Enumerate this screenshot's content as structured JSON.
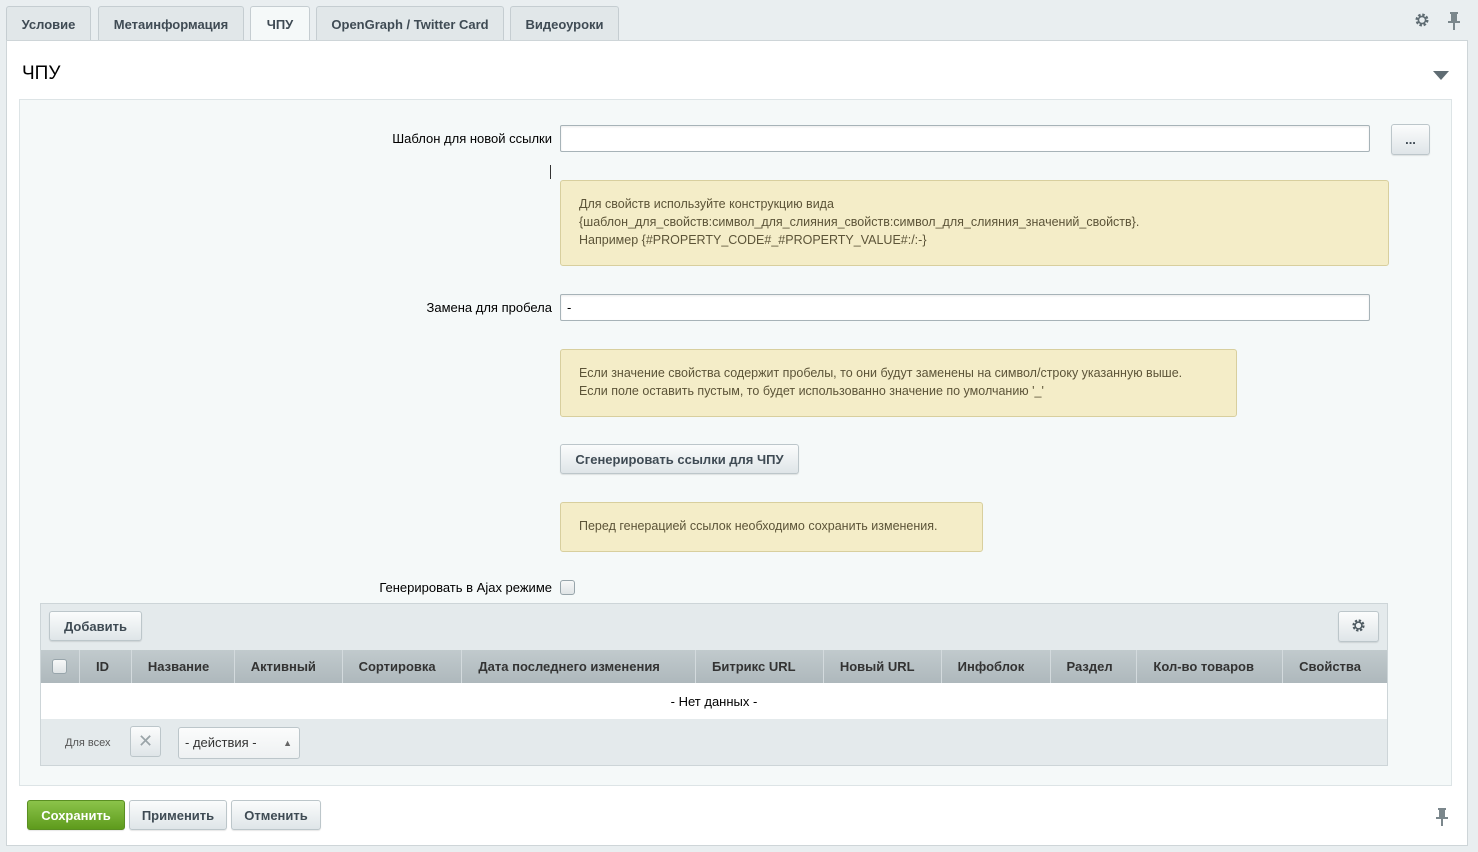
{
  "tabs": [
    {
      "label": "Условие",
      "active": false
    },
    {
      "label": "Метаинформация",
      "active": false
    },
    {
      "label": "ЧПУ",
      "active": true
    },
    {
      "label": "OpenGraph / Twitter Card",
      "active": false
    },
    {
      "label": "Видеоуроки",
      "active": false
    }
  ],
  "top_icons": [
    "gear-icon",
    "pin-icon"
  ],
  "section": {
    "title": "ЧПУ"
  },
  "form": {
    "template_label": "Шаблон для новой ссылки",
    "template_value": "",
    "template_button": "...",
    "template_note": [
      "Для свойств используйте конструкцию вида",
      "{шаблон_для_свойств:символ_для_слияния_свойств:символ_для_слияния_значений_свойств}.",
      "Например {#PROPERTY_CODE#_#PROPERTY_VALUE#:/:-}"
    ],
    "space_label": "Замена для пробела",
    "space_value": "-",
    "space_note": [
      "Если значение свойства содержит пробелы, то они будут заменены на символ/строку указанную выше.",
      "Если поле оставить пустым, то будет использованно значение по умолчанию '_'"
    ],
    "generate_button": "Сгенерировать ссылки для ЧПУ",
    "generate_note": "Перед генерацией ссылок необходимо сохранить изменения.",
    "ajax_label": "Генерировать в Ajax режиме",
    "ajax_checked": false
  },
  "grid": {
    "add_button": "Добавить",
    "columns": [
      "ID",
      "Название",
      "Активный",
      "Сортировка",
      "Дата последнего изменения",
      "Битрикс URL",
      "Новый URL",
      "Инфоблок",
      "Раздел",
      "Кол-во товаров",
      "Свойства"
    ],
    "empty_text": "- Нет данных -",
    "footer_label": "Для всех",
    "actions_select": "- действия -"
  },
  "bottom": {
    "save": "Сохранить",
    "apply": "Применить",
    "cancel": "Отменить"
  },
  "colors": {
    "save_button": "#6fa926",
    "note_bg": "#f4edc8"
  }
}
